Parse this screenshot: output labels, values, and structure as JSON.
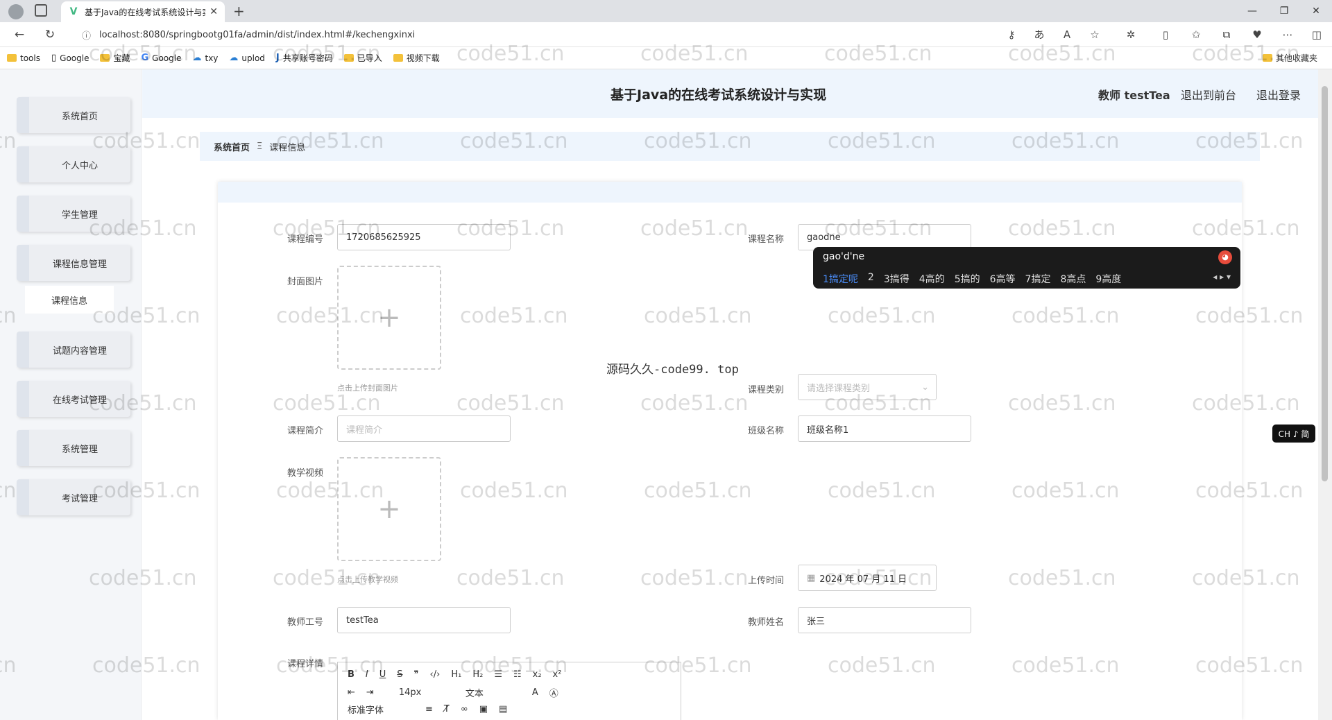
{
  "browser": {
    "tab_title": "基于Java的在线考试系统设计与实现",
    "url": "localhost:8080/springbootg01fa/admin/dist/index.html#/kechengxinxi",
    "bookmarks": [
      "tools",
      "Google",
      "宝藏",
      "Google",
      "txy",
      "uplod",
      "共享账号密码",
      "已导入",
      "视频下载"
    ],
    "other_bookmarks": "其他收藏夹"
  },
  "header": {
    "title": "基于Java的在线考试系统设计与实现",
    "user": "教师 testTea",
    "back_front": "退出到前台",
    "logout": "退出登录"
  },
  "sidebar": {
    "items": [
      "系统首页",
      "个人中心",
      "学生管理",
      "课程信息管理",
      "试题内容管理",
      "在线考试管理",
      "系统管理",
      "考试管理"
    ],
    "subitem": "课程信息"
  },
  "breadcrumb": {
    "home": "系统首页",
    "sep": "Ξ",
    "current": "课程信息"
  },
  "form": {
    "course_no_label": "课程编号",
    "course_no": "1720685625925",
    "course_name_label": "课程名称",
    "course_name": "gaodne",
    "cover_label": "封面图片",
    "cover_hint": "点击上传封面图片",
    "category_label": "课程类别",
    "category_placeholder": "请选择课程类别",
    "intro_label": "课程简介",
    "intro_placeholder": "课程简介",
    "class_label": "班级名称",
    "class_value": "班级名称1",
    "video_label": "教学视频",
    "video_hint": "点击上传教学视频",
    "upload_time_label": "上传时间",
    "upload_time": "2024 年 07 月 11 日",
    "teacher_no_label": "教师工号",
    "teacher_no": "testTea",
    "teacher_name_label": "教师姓名",
    "teacher_name": "张三",
    "detail_label": "课程详情"
  },
  "editor": {
    "font_size": "14px",
    "text_type": "文本",
    "font_family": "标准字体"
  },
  "ime": {
    "composition": "gao'd'ne",
    "candidates": [
      "1搞定呢",
      "2",
      "3搞得",
      "4高的",
      "5搞的",
      "6高等",
      "7搞定",
      "8高点",
      "9高度"
    ]
  },
  "ime_mode": "CH ♪ 简",
  "overlay_text": "源码久久-code99. top",
  "watermark": "code51.cn"
}
